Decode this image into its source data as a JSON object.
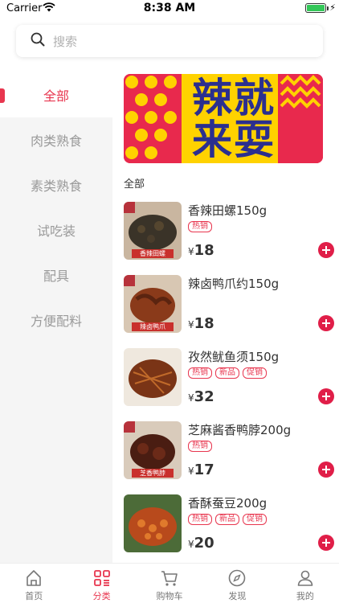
{
  "status_bar": {
    "carrier": "Carrier",
    "time": "8:38 AM"
  },
  "search": {
    "placeholder": "搜索"
  },
  "sidebar": {
    "items": [
      {
        "label": "全部",
        "active": true
      },
      {
        "label": "肉类熟食"
      },
      {
        "label": "素类熟食"
      },
      {
        "label": "试吃装"
      },
      {
        "label": "配具"
      },
      {
        "label": "方便配料"
      }
    ]
  },
  "banner": {
    "text": "辣就来耍"
  },
  "section": {
    "title": "全部"
  },
  "products": [
    {
      "name": "香辣田螺150g",
      "tags": [
        "热销"
      ],
      "currency": "¥",
      "price": "18",
      "thumb_caption": "香辣田螺"
    },
    {
      "name": "辣卤鸭爪约150g",
      "tags": [],
      "currency": "¥",
      "price": "18",
      "thumb_caption": "辣卤鸭爪"
    },
    {
      "name": "孜然鱿鱼须150g",
      "tags": [
        "热销",
        "新品",
        "促销"
      ],
      "currency": "¥",
      "price": "32",
      "thumb_caption": ""
    },
    {
      "name": "芝麻酱香鸭脖200g",
      "tags": [
        "热销"
      ],
      "currency": "¥",
      "price": "17",
      "thumb_caption": "芝香鸭脖"
    },
    {
      "name": "香酥蚕豆200g",
      "tags": [
        "热销",
        "新品",
        "促销"
      ],
      "currency": "¥",
      "price": "20",
      "thumb_caption": ""
    }
  ],
  "tab_bar": {
    "items": [
      {
        "label": "首页",
        "icon": "home-icon"
      },
      {
        "label": "分类",
        "icon": "category-icon",
        "active": true
      },
      {
        "label": "购物车",
        "icon": "cart-icon"
      },
      {
        "label": "发现",
        "icon": "compass-icon"
      },
      {
        "label": "我的",
        "icon": "profile-icon"
      }
    ]
  },
  "colors": {
    "accent": "#e8364f",
    "add_button": "#e01e48",
    "banner_bg": "#e8294d",
    "banner_yellow": "#ffd200",
    "banner_text": "#2b2f8f"
  }
}
